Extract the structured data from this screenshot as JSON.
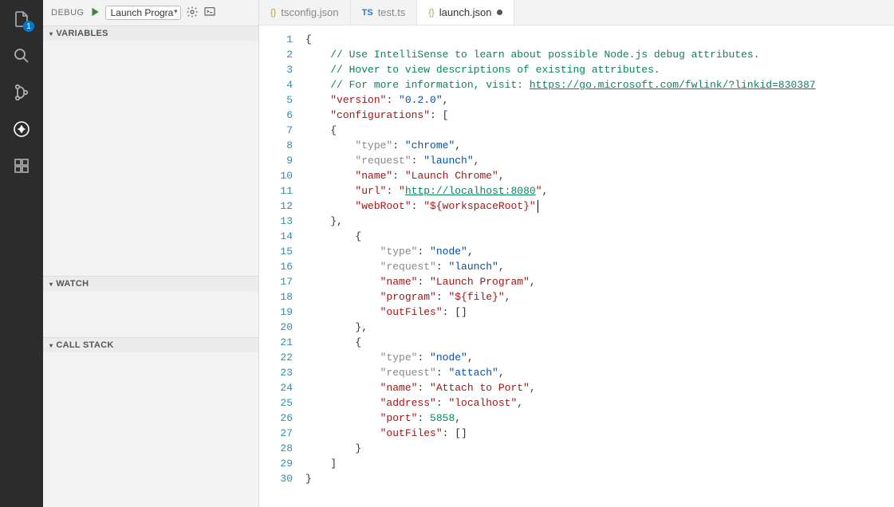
{
  "activity": {
    "badge": "1"
  },
  "debug": {
    "title": "DEBUG",
    "selected_config": "Launch Progra",
    "sections": {
      "variables": "VARIABLES",
      "watch": "WATCH",
      "callstack": "CALL STACK"
    }
  },
  "tabs": [
    {
      "icon": "{}",
      "label": "tsconfig.json",
      "active": false,
      "dirty": false,
      "iconClass": "ficon-json"
    },
    {
      "icon": "TS",
      "label": "test.ts",
      "active": false,
      "dirty": false,
      "iconClass": "ficon-ts"
    },
    {
      "icon": "{}",
      "label": "launch.json",
      "active": true,
      "dirty": true,
      "iconClass": "ficon-json"
    }
  ],
  "code": {
    "line_count": 30,
    "comment1": "// Use IntelliSense to learn about possible Node.js debug attributes.",
    "comment2": "// Hover to view descriptions of existing attributes.",
    "comment3_prefix": "// For more information, visit: ",
    "comment3_url": "https://go.microsoft.com/fwlink/?linkid=830387",
    "k_version": "\"version\"",
    "v_version": "\"0.2.0\"",
    "k_configs": "\"configurations\"",
    "k_type": "\"type\"",
    "v_chrome": "\"chrome\"",
    "k_request": "\"request\"",
    "v_launch": "\"launch\"",
    "k_name": "\"name\"",
    "v_launchchrome": "\"Launch Chrome\"",
    "k_url": "\"url\"",
    "v_url_open": "\"",
    "v_url_link": "http://localhost:8080",
    "v_url_close": "\"",
    "k_webroot": "\"webRoot\"",
    "v_webroot": "\"${workspaceRoot}\"",
    "v_node": "\"node\"",
    "v_launchprog": "\"Launch Program\"",
    "k_program": "\"program\"",
    "v_program": "\"${file}\"",
    "k_outfiles": "\"outFiles\"",
    "v_attach": "\"attach\"",
    "v_attachport": "\"Attach to Port\"",
    "k_address": "\"address\"",
    "v_localhost": "\"localhost\"",
    "k_port": "\"port\"",
    "v_port": "5858"
  }
}
